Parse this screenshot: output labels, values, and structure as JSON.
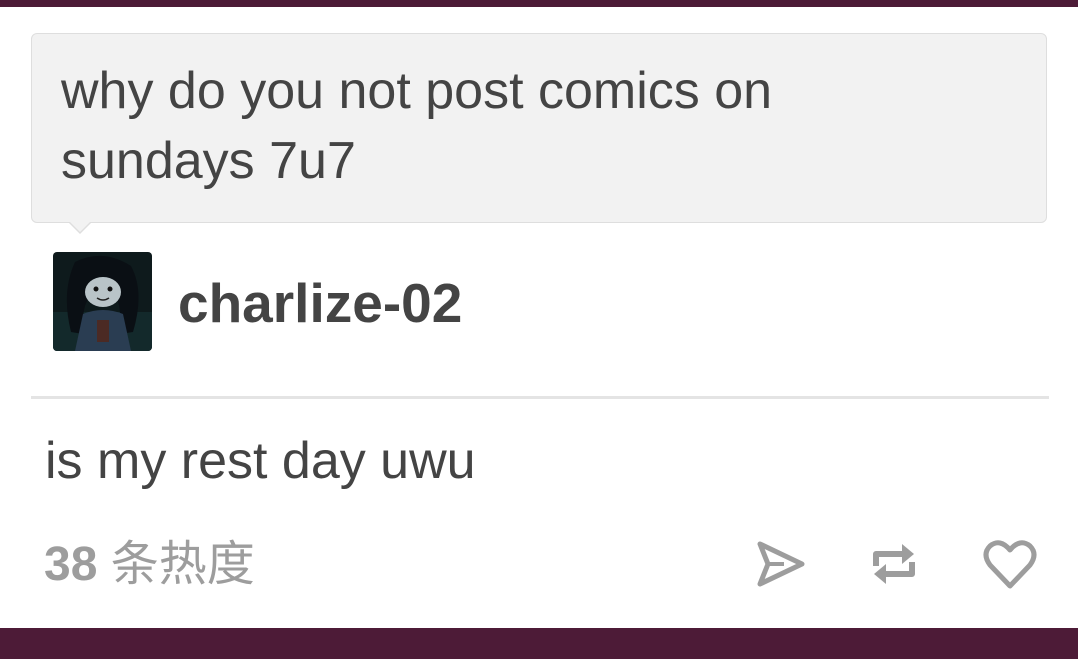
{
  "question": {
    "text": "why do you not post comics on sundays 7u7"
  },
  "asker": {
    "name": "charlize-02"
  },
  "answer": {
    "text": "is my rest day uwu"
  },
  "footer": {
    "notes_number": "38",
    "notes_label": "条热度",
    "icons": [
      "share-icon",
      "reblog-icon",
      "like-icon"
    ]
  },
  "colors": {
    "bar": "#4d1b37",
    "bubble": "#f2f2f2",
    "text": "#444444",
    "muted": "#9d9d9d"
  }
}
